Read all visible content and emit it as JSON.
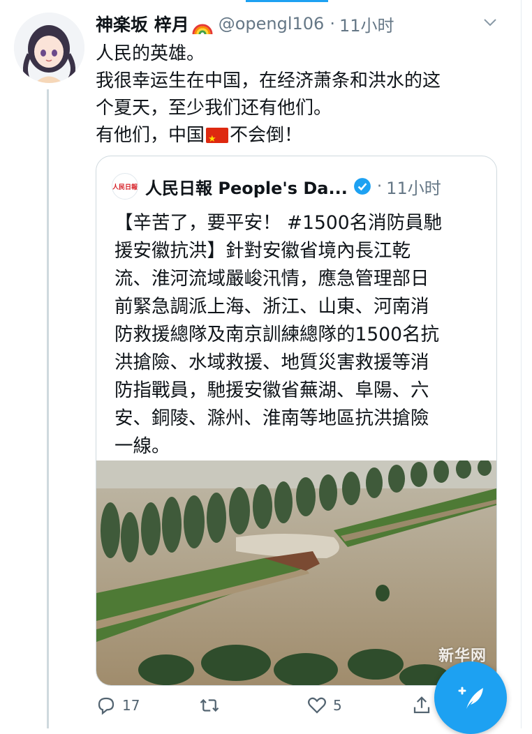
{
  "tweet": {
    "display_name": "神楽坂 梓月",
    "handle": "@opengl106",
    "separator": "·",
    "time": "11小时",
    "lines": [
      "人民的英雄。",
      "我很幸运生在中国，在经济萧条和洪水的这",
      "个夏天，至少我们还有他们。"
    ],
    "last_line_before_flag": "有他们，中国",
    "last_line_after_flag": "不会倒！"
  },
  "quote": {
    "display_name": "人民日報 People's Da...",
    "separator": "·",
    "time": "11小时",
    "logo_text": "人民日報",
    "lines": [
      "【辛苦了，要平安！ #1500名消防員馳",
      "援安徽抗洪】針對安徽省境內長江乾",
      "流、淮河流域嚴峻汛情，應急管理部日",
      "前緊急調派上海、浙江、山東、河南消",
      "防救援總隊及南京訓練總隊的1500名抗",
      "洪搶險、水域救援、地質災害救援等消",
      "防指戰員，馳援安徽省蕪湖、阜陽、六",
      "安、銅陵、滁州、淮南等地區抗洪搶險",
      "一線。"
    ],
    "image_watermark": "新华网"
  },
  "actions": {
    "reply_count": "17",
    "like_count": "5"
  },
  "colors": {
    "accent": "#1da1f2",
    "secondary_text": "#657786",
    "border": "#cfd9de"
  }
}
